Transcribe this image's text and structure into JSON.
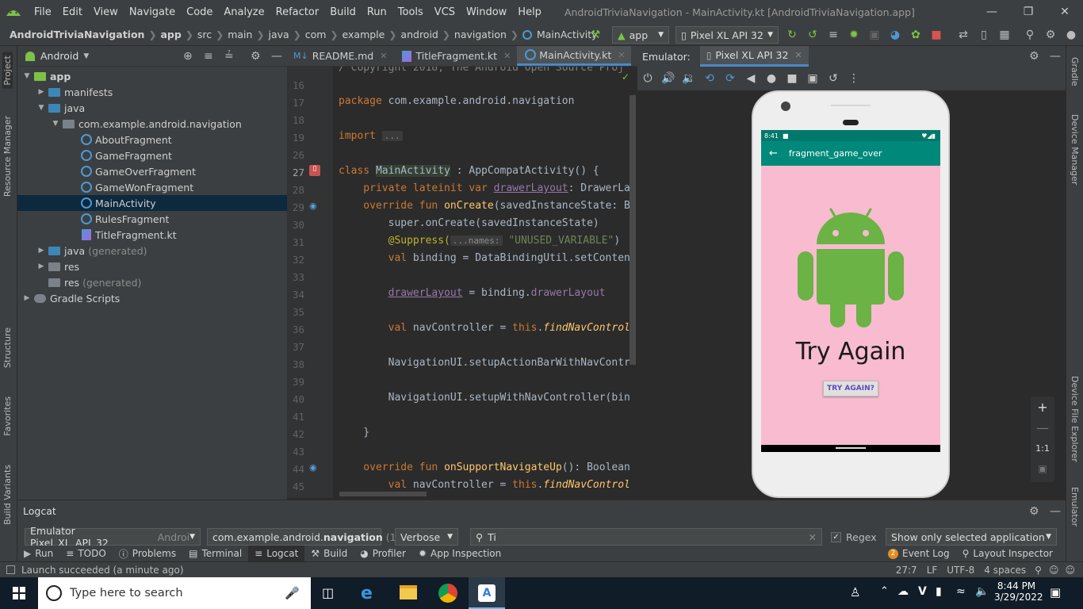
{
  "menubar": {
    "items": [
      "File",
      "Edit",
      "View",
      "Navigate",
      "Code",
      "Analyze",
      "Refactor",
      "Build",
      "Run",
      "Tools",
      "VCS",
      "Window",
      "Help"
    ],
    "window_title": "AndroidTriviaNavigation - MainActivity.kt [AndroidTriviaNavigation.app]"
  },
  "breadcrumb": [
    "AndroidTriviaNavigation",
    "app",
    "src",
    "main",
    "java",
    "com",
    "example",
    "android",
    "navigation",
    "MainActivity"
  ],
  "toolbar": {
    "run_config": "app",
    "device": "Pixel XL API 32"
  },
  "left_strip": {
    "project": "Project",
    "resource_manager": "Resource Manager",
    "structure": "Structure",
    "favorites": "Favorites",
    "build_variants": "Build Variants"
  },
  "right_strip": {
    "gradle": "Gradle",
    "device_manager": "Device Manager",
    "device_file_explorer": "Device File Explorer",
    "emulator": "Emulator"
  },
  "project": {
    "view_mode": "Android",
    "tree": [
      {
        "label": "app",
        "muted": ""
      },
      {
        "label": "manifests",
        "muted": ""
      },
      {
        "label": "java",
        "muted": ""
      },
      {
        "label": "com.example.android.navigation",
        "muted": ""
      },
      {
        "label": "AboutFragment",
        "muted": ""
      },
      {
        "label": "GameFragment",
        "muted": ""
      },
      {
        "label": "GameOverFragment",
        "muted": ""
      },
      {
        "label": "GameWonFragment",
        "muted": ""
      },
      {
        "label": "MainActivity",
        "muted": ""
      },
      {
        "label": "RulesFragment",
        "muted": ""
      },
      {
        "label": "TitleFragment.kt",
        "muted": ""
      },
      {
        "label": "java",
        "muted": "(generated)"
      },
      {
        "label": "res",
        "muted": ""
      },
      {
        "label": "res",
        "muted": "(generated)"
      },
      {
        "label": "Gradle Scripts",
        "muted": ""
      }
    ]
  },
  "editor": {
    "tabs": [
      "README.md",
      "TitleFragment.kt",
      "MainActivity.kt"
    ],
    "line_numbers": [
      "16",
      "17",
      "18",
      "19",
      "26",
      "27",
      "28",
      "29",
      "30",
      "31",
      "32",
      "33",
      "34",
      "35",
      "36",
      "37",
      "38",
      "39",
      "40",
      "41",
      "42",
      "43",
      "44",
      "45"
    ],
    "lines": {
      "l16": "/ Copyright 2018, The Android Open Source Proj",
      "l17a": "package ",
      "l17b": "com.example.android.navigation",
      "l19a": "import ",
      "l19b": "...",
      "l27a": "class ",
      "l27b": "MainActivity",
      "l27c": " : AppCompatActivity() {",
      "l28a": "    private lateinit var ",
      "l28b": "drawerLayout",
      "l28c": ": DrawerLa",
      "l29a": "    override fun ",
      "l29b": "onCreate",
      "l29c": "(savedInstanceState: B",
      "l30": "        super.onCreate(savedInstanceState)",
      "l31a": "        @Suppress(",
      "l31b": "...names:",
      "l31c": " \"UNUSED_VARIABLE\"",
      "l31d": ")",
      "l32a": "        val ",
      "l32b": "binding = DataBindingUtil.setConten",
      "l34a": "        ",
      "l34b": "drawerLayout",
      "l34c": " = binding.",
      "l34d": "drawerLayout",
      "l36a": "        val ",
      "l36b": "navController = ",
      "l36c": "this",
      "l36d": ".",
      "l36e": "findNavControl",
      "l38": "        NavigationUI.setupActionBarWithNavContr",
      "l40": "        NavigationUI.setupWithNavController(bin",
      "l42": "    }",
      "l44a": "    override fun ",
      "l44b": "onSupportNavigateUp",
      "l44c": "(): Boolean",
      "l45a": "        val ",
      "l45b": "navController = ",
      "l45c": "this",
      "l45d": ".",
      "l45e": "findNavControl"
    }
  },
  "emulator": {
    "label": "Emulator:",
    "device_tab": "Pixel XL API 32",
    "status_time": "8:41",
    "appbar_title": "fragment_game_over",
    "headline": "Try Again",
    "button_label": "TRY AGAIN?",
    "zoom_ratio": "1:1"
  },
  "logcat": {
    "title": "Logcat",
    "device": "Emulator Pixel_XL_API_32",
    "device_suffix": "Androi",
    "package_prefix": "com.example.android.",
    "package_bold": "navigation",
    "package_suffix": "(1",
    "level": "Verbose",
    "search": "Ti",
    "regex_label": "Regex",
    "filter": "Show only selected application"
  },
  "toolwindows": [
    "Run",
    "TODO",
    "Problems",
    "Terminal",
    "Logcat",
    "Build",
    "Profiler",
    "App Inspection"
  ],
  "toolwindows_right": {
    "event_log": "Event Log",
    "event_log_count": "2",
    "layout_inspector": "Layout Inspector"
  },
  "statusline": {
    "message": "Launch succeeded (a minute ago)",
    "position": "27:7",
    "line_sep": "LF",
    "encoding": "UTF-8",
    "indent": "4 spaces"
  },
  "taskbar": {
    "search_placeholder": "Type here to search",
    "time": "8:44 PM",
    "date": "3/29/2022"
  },
  "colors": {
    "accent": "#4a88c7",
    "android_green": "#6ab344",
    "teal": "#00897b",
    "pink": "#f8bbd0"
  }
}
